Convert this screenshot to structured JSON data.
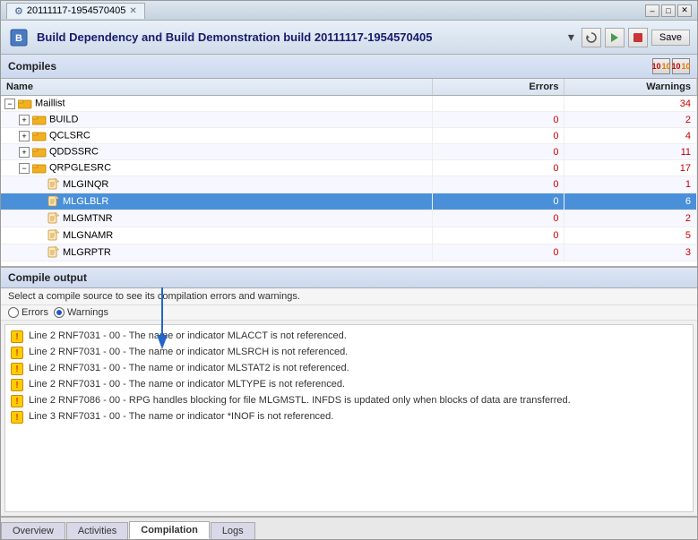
{
  "window": {
    "title": "20111117-1954570405",
    "close_icon": "✕"
  },
  "app_header": {
    "title": "Build Dependency and Build Demonstration build 20111117-1954570405",
    "dropdown_icon": "▾",
    "toolbar": {
      "btn1": "🔄",
      "btn2": "▶",
      "btn3": "⏹",
      "save": "Save"
    }
  },
  "compiles_section": {
    "label": "Compiles",
    "icon1": "10",
    "icon2": "10"
  },
  "table": {
    "columns": [
      "Name",
      "Errors",
      "Warnings"
    ],
    "rows": [
      {
        "indent": 1,
        "expandable": true,
        "expanded": true,
        "icon": "folder",
        "name": "Maillist",
        "errors": "",
        "warnings": "34",
        "level": 0
      },
      {
        "indent": 2,
        "expandable": true,
        "expanded": false,
        "icon": "folder",
        "name": "BUILD",
        "errors": "0",
        "warnings": "2",
        "level": 1
      },
      {
        "indent": 2,
        "expandable": true,
        "expanded": false,
        "icon": "folder",
        "name": "QCLSRC",
        "errors": "0",
        "warnings": "4",
        "level": 1
      },
      {
        "indent": 2,
        "expandable": true,
        "expanded": false,
        "icon": "folder",
        "name": "QDDSSRC",
        "errors": "0",
        "warnings": "11",
        "level": 1
      },
      {
        "indent": 2,
        "expandable": true,
        "expanded": true,
        "icon": "folder",
        "name": "QRPGLESRC",
        "errors": "0",
        "warnings": "17",
        "level": 1
      },
      {
        "indent": 3,
        "expandable": false,
        "expanded": false,
        "icon": "file",
        "name": "MLGINQR",
        "errors": "0",
        "warnings": "1",
        "level": 2
      },
      {
        "indent": 3,
        "expandable": false,
        "expanded": false,
        "icon": "file",
        "name": "MLGLBLR",
        "errors": "0",
        "warnings": "6",
        "level": 2,
        "selected": true
      },
      {
        "indent": 3,
        "expandable": false,
        "expanded": false,
        "icon": "file",
        "name": "MLGMTNR",
        "errors": "0",
        "warnings": "2",
        "level": 2
      },
      {
        "indent": 3,
        "expandable": false,
        "expanded": false,
        "icon": "file",
        "name": "MLGNAMR",
        "errors": "0",
        "warnings": "5",
        "level": 2
      },
      {
        "indent": 3,
        "expandable": false,
        "expanded": false,
        "icon": "file",
        "name": "MLGRPTR",
        "errors": "0",
        "warnings": "3",
        "level": 2
      }
    ]
  },
  "compile_output": {
    "header": "Compile output",
    "instruction": "Select a compile source to see its compilation errors and warnings.",
    "filter": {
      "errors_label": "Errors",
      "warnings_label": "Warnings",
      "selected": "Warnings"
    },
    "messages": [
      {
        "line": "Line 2",
        "code": "RNF7031",
        "dash": "- 00 -",
        "text": "The name or indicator MLACCT is not referenced."
      },
      {
        "line": "Line 2",
        "code": "RNF7031",
        "dash": "- 00 -",
        "text": "The name or indicator MLSRCH is not referenced."
      },
      {
        "line": "Line 2",
        "code": "RNF7031",
        "dash": "- 00 -",
        "text": "The name or indicator MLSTAT2 is not referenced."
      },
      {
        "line": "Line 2",
        "code": "RNF7031",
        "dash": "- 00 -",
        "text": "The name or indicator MLTYPE is not referenced."
      },
      {
        "line": "Line 2",
        "code": "RNF7086",
        "dash": "- 00 -",
        "text": "RPG handles blocking for file MLGMSTL. INFDS is updated only when blocks of data are transferred."
      },
      {
        "line": "Line 3",
        "code": "RNF7031",
        "dash": "- 00 -",
        "text": "The name or indicator *INOF is not referenced."
      }
    ]
  },
  "bottom_tabs": [
    {
      "label": "Overview",
      "active": false
    },
    {
      "label": "Activities",
      "active": false
    },
    {
      "label": "Compilation",
      "active": true
    },
    {
      "label": "Logs",
      "active": false
    }
  ],
  "win_controls": {
    "minimize": "–",
    "maximize": "□",
    "close": "✕"
  }
}
